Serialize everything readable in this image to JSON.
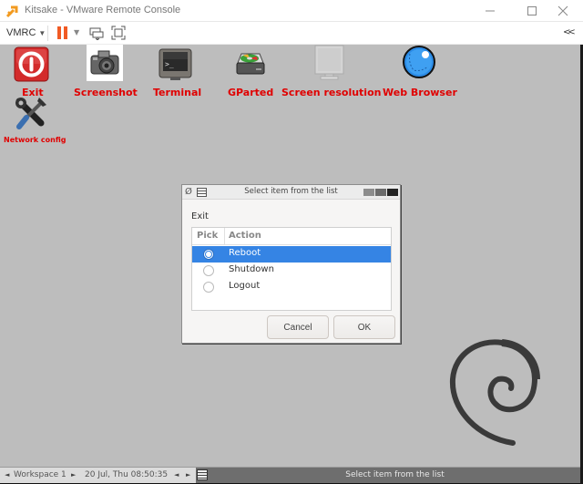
{
  "window": {
    "title": "Kitsake - VMware Remote Console",
    "controls": {
      "minimize": "minimize-icon",
      "maximize": "maximize-icon",
      "close": "close-icon"
    }
  },
  "toolbar": {
    "vmrc_label": "VMRC",
    "power_pause": "pause-icon",
    "send_keys": "send-keys-icon",
    "fullscreen": "fullscreen-icon",
    "collapse": "collapse-icon",
    "pause_color": "#f15a24"
  },
  "desktop": {
    "label_color": "#e00000",
    "background": "#bdbdbd",
    "icons": [
      {
        "label": "Exit",
        "icon": "power-icon"
      },
      {
        "label": "Screenshot",
        "icon": "camera-icon"
      },
      {
        "label": "Terminal",
        "icon": "terminal-icon"
      },
      {
        "label": "GParted",
        "icon": "disk-icon"
      },
      {
        "label": "Screen resolution",
        "icon": "monitor-icon"
      },
      {
        "label": "Web Browser",
        "icon": "globe-icon"
      },
      {
        "label": "Network config",
        "icon": "tools-icon"
      }
    ]
  },
  "dialog": {
    "title": "Select item from the list",
    "prompt": "Exit",
    "columns": [
      "Pick",
      "Action"
    ],
    "rows": [
      {
        "action": "Reboot",
        "selected": true
      },
      {
        "action": "Shutdown",
        "selected": false
      },
      {
        "action": "Logout",
        "selected": false
      }
    ],
    "cancel_label": "Cancel",
    "ok_label": "OK",
    "selection_color": "#3584e4"
  },
  "taskbar": {
    "workspace": "Workspace 1",
    "clock": "20 Jul, Thu 08:50:35",
    "active_task": "Select item from the list"
  }
}
